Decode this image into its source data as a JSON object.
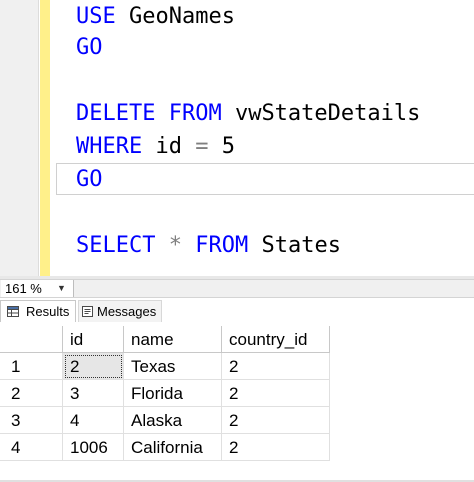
{
  "editor": {
    "lines": [
      {
        "kw": "USE",
        "rest": " GeoNames"
      },
      {
        "kw": "GO",
        "rest": ""
      },
      {
        "kw": "DELETE FROM",
        "rest": " vwStateDetails"
      },
      {
        "kw": "WHERE",
        "rest": " id ",
        "op": "=",
        "rest2": " 5"
      },
      {
        "kw": "GO",
        "rest": ""
      },
      {
        "kw": "SELECT",
        "op": " * ",
        "kw2": "FROM",
        "rest": " States"
      }
    ]
  },
  "status": {
    "zoom": "161 %"
  },
  "tabs": {
    "results": "Results",
    "messages": "Messages"
  },
  "grid": {
    "columns": [
      "id",
      "name",
      "country_id"
    ],
    "rows": [
      {
        "num": "1",
        "id": "2",
        "name": "Texas",
        "country_id": "2"
      },
      {
        "num": "2",
        "id": "3",
        "name": "Florida",
        "country_id": "2"
      },
      {
        "num": "3",
        "id": "4",
        "name": "Alaska",
        "country_id": "2"
      },
      {
        "num": "4",
        "id": "1006",
        "name": "California",
        "country_id": "2"
      }
    ]
  },
  "colors": {
    "keyword": "#0000ff",
    "operator": "#808080",
    "change_bar": "#fff08a",
    "selected_cell": "#e6e6e6"
  },
  "icons": [
    "dropdown-arrow-icon",
    "results-grid-icon",
    "messages-icon"
  ]
}
